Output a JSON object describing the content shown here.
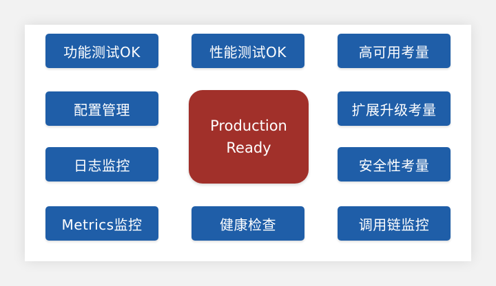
{
  "colors": {
    "tile_fill": "#1f5ea8",
    "center_fill": "#a1302a",
    "text": "#ffffff"
  },
  "tiles": {
    "left": [
      "功能测试OK",
      "配置管理",
      "日志监控",
      "Metrics监控"
    ],
    "middle": [
      "性能测试OK",
      "健康检查"
    ],
    "right": [
      "高可用考量",
      "扩展升级考量",
      "安全性考量",
      "调用链监控"
    ]
  },
  "center": {
    "line1": "Production",
    "line2": "Ready"
  }
}
